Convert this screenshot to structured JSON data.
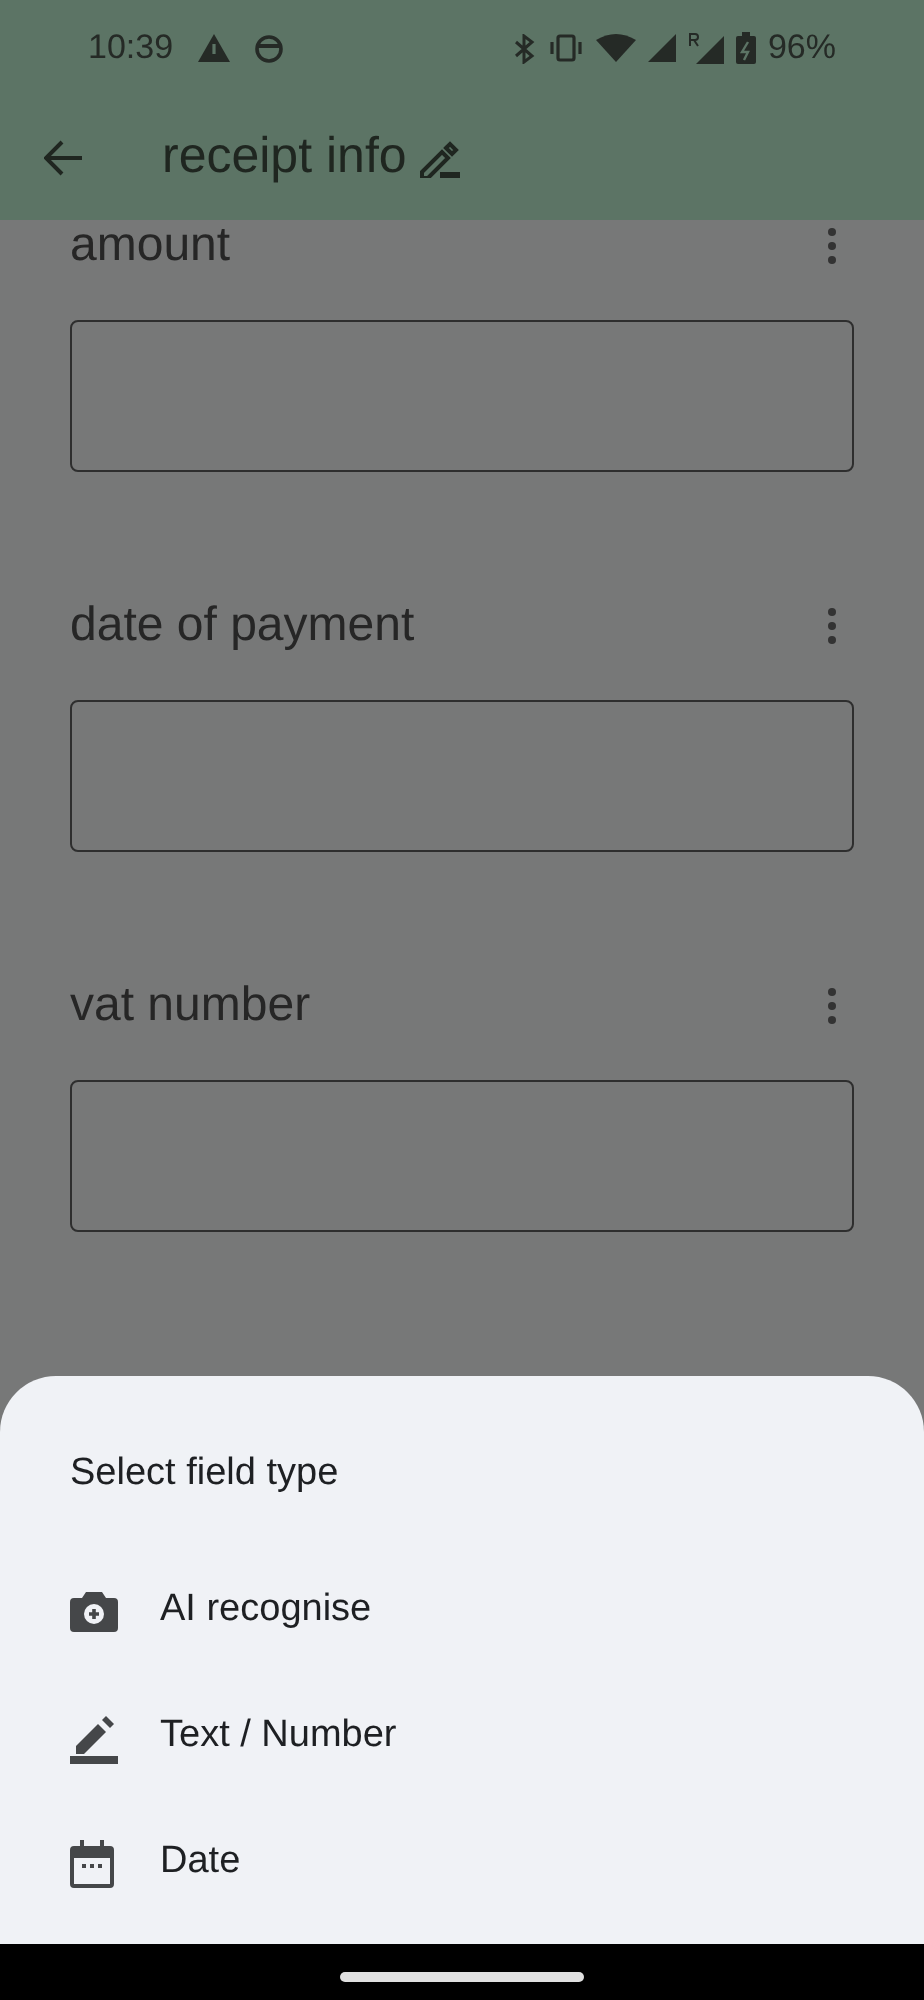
{
  "status_bar": {
    "time": "10:39",
    "battery": "96%"
  },
  "app_bar": {
    "title": "receipt info"
  },
  "fields": [
    {
      "label": "amount"
    },
    {
      "label": "date of payment"
    },
    {
      "label": "vat number"
    }
  ],
  "sheet": {
    "title": "Select field type",
    "options": [
      {
        "kind": "camera",
        "label": "AI recognise"
      },
      {
        "kind": "text",
        "label": "Text / Number"
      },
      {
        "kind": "date",
        "label": "Date"
      }
    ]
  }
}
